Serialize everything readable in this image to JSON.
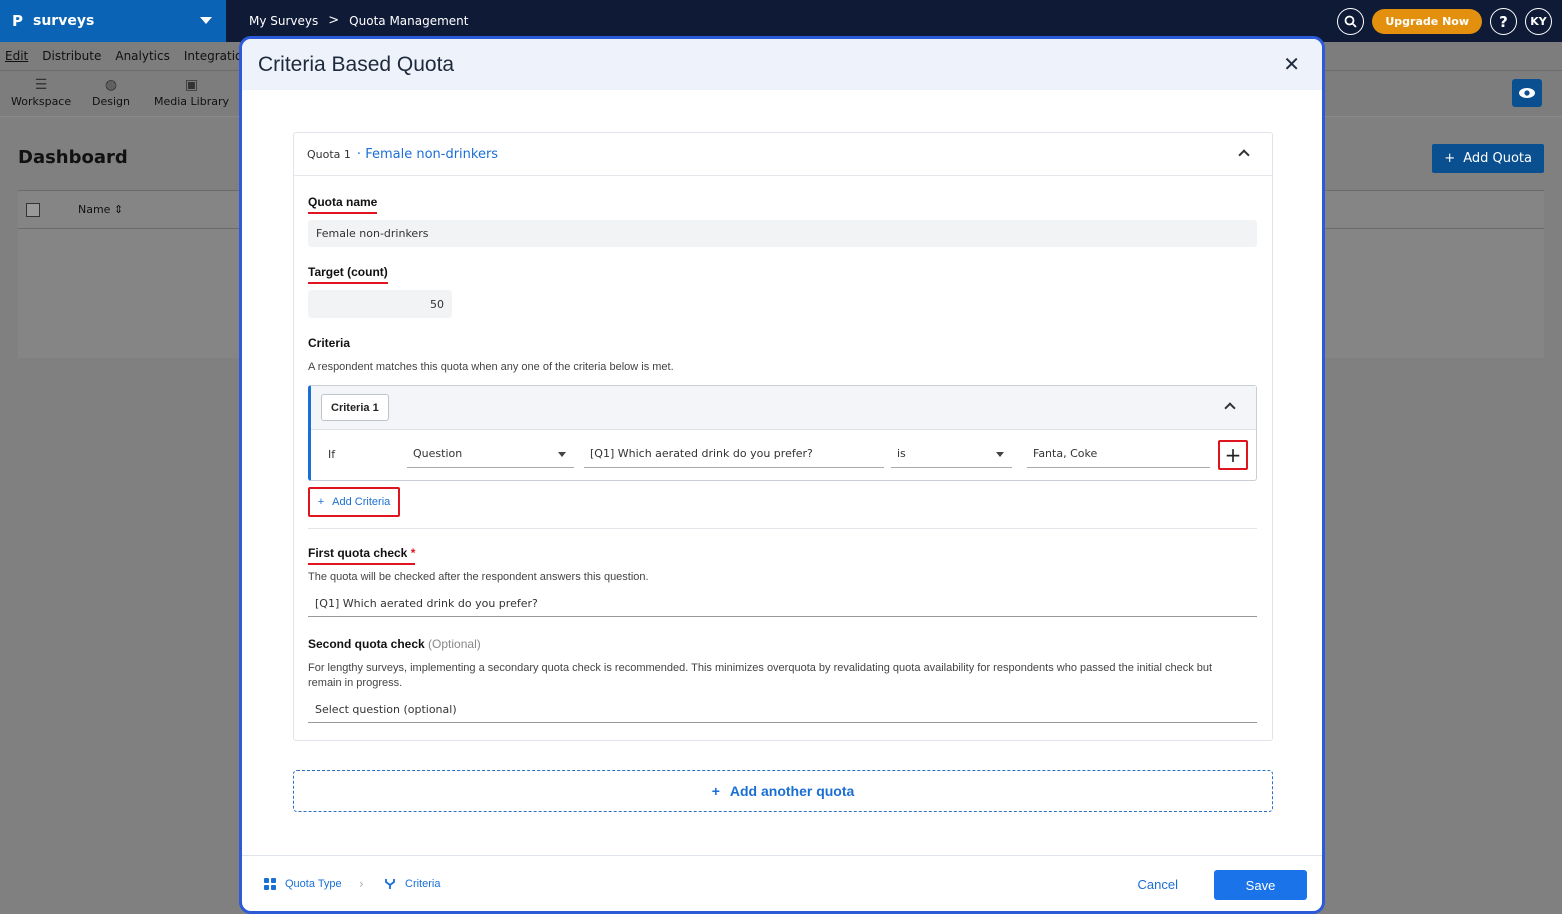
{
  "app": {
    "brand_logo": "P",
    "brand_name": "surveys",
    "breadcrumb": [
      "My Surveys",
      "Quota Management"
    ],
    "breadcrumb_sep": ">",
    "upgrade_label": "Upgrade Now",
    "help_label": "?",
    "avatar_initials": "KY"
  },
  "menu": [
    "Edit",
    "Distribute",
    "Analytics",
    "Integration"
  ],
  "toolbar": [
    "Workspace",
    "Design",
    "Media Library"
  ],
  "dashboard": {
    "title": "Dashboard",
    "add_quota_label": "Add Quota",
    "name_col": "Name"
  },
  "modal": {
    "title": "Criteria Based Quota",
    "close_label": "✕",
    "quota_number": "Quota 1",
    "quota_title": "Female non-drinkers",
    "quota_name_label": "Quota name",
    "quota_name_value": "Female non-drinkers",
    "target_label": "Target (count)",
    "target_value": "50",
    "criteria_label": "Criteria",
    "criteria_help": "A respondent matches this quota when any one of the criteria below is met.",
    "criteria_item": {
      "tag": "Criteria 1",
      "if_label": "If",
      "type": "Question",
      "question": "[Q1] Which aerated drink do you prefer?",
      "operator": "is",
      "value": "Fanta, Coke"
    },
    "add_criteria_label": "Add Criteria",
    "first_check_label": "First quota check",
    "first_check_help": "The quota will be checked after the respondent answers this question.",
    "first_check_value": "[Q1] Which aerated drink do you prefer?",
    "second_check_label": "Second quota check",
    "second_check_optional": "(Optional)",
    "second_check_help": "For lengthy surveys, implementing a secondary quota check is recommended. This minimizes overquota by revalidating quota availability for respondents who passed the initial check but remain in progress.",
    "second_check_placeholder": "Select question (optional)",
    "add_another_label": "Add another quota"
  },
  "footer": {
    "step1": "Quota Type",
    "step2": "Criteria",
    "cancel_label": "Cancel",
    "save_label": "Save"
  },
  "colors": {
    "accent": "#1a73e8",
    "highlight": "#e0141e",
    "upgrade": "#e3900e",
    "topbar": "#0e1a36"
  }
}
